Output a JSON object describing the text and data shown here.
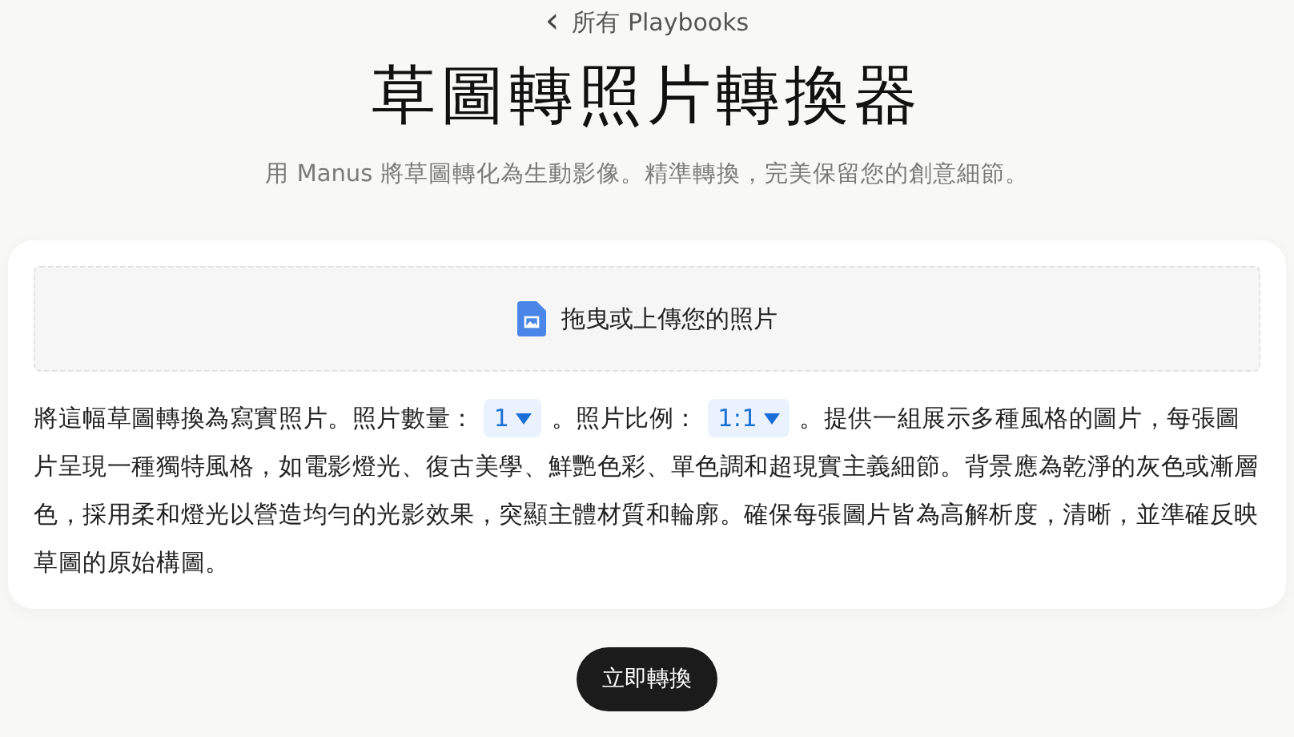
{
  "back_link": {
    "icon": "‹",
    "label": "所有 Playbooks"
  },
  "title": "草圖轉照片轉換器",
  "subtitle": "用 Manus 將草圖轉化為生動影像。精準轉換，完美保留您的創意細節。",
  "upload": {
    "label": "拖曳或上傳您的照片"
  },
  "prompt": [
    {
      "kind": "text",
      "text": "將這幅草圖轉換為寫實照片。照片數量："
    },
    {
      "kind": "select",
      "value": "1"
    },
    {
      "kind": "text",
      "text": "。照片比例："
    },
    {
      "kind": "select",
      "value": "1:1"
    },
    {
      "kind": "text",
      "text": "。提供一組展示多種風格的圖片，每張圖片呈現一種獨特風格，如電影燈光、復古美學、鮮艷色彩、單色調和超現實主義細節。背景應為乾淨的灰色或漸層色，採用柔和燈光以營造均勻的光影效果，突顯主體材質和輪廓。確保每張圖片皆為高解析度，清晰，並準確反映草圖的原始構圖。"
    }
  ],
  "submit_button": "立即轉換"
}
